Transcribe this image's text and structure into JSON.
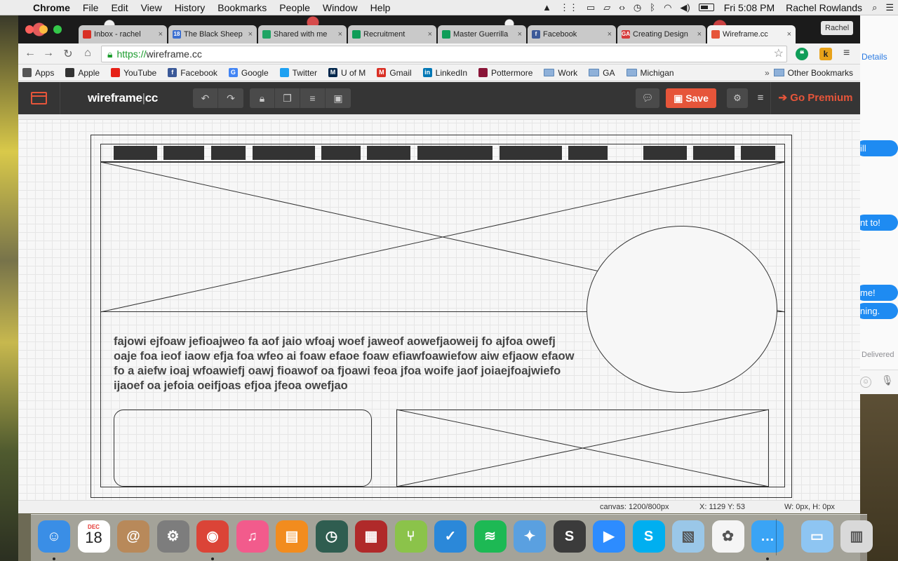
{
  "menubar": {
    "app_name": "Chrome",
    "items": [
      "File",
      "Edit",
      "View",
      "History",
      "Bookmarks",
      "People",
      "Window",
      "Help"
    ],
    "clock": "Fri 5:08 PM",
    "user": "Rachel Rowlands"
  },
  "browser": {
    "tabs": [
      {
        "label": "Inbox - rachel",
        "icon": "gmail-icon",
        "color": "#d93025"
      },
      {
        "label": "The Black Sheep",
        "icon": "calendar-icon",
        "color": "#3b6fd1",
        "icon_text": "18"
      },
      {
        "label": "Shared with me",
        "icon": "drive-icon",
        "color": "#1fa463"
      },
      {
        "label": "Recruitment",
        "icon": "sheets-icon",
        "color": "#0f9d58"
      },
      {
        "label": "Master Guerrilla",
        "icon": "sheets-icon",
        "color": "#0f9d58"
      },
      {
        "label": "Facebook",
        "icon": "facebook-icon",
        "color": "#3b5998",
        "icon_text": "f"
      },
      {
        "label": "Creating Design",
        "icon": "ga-icon",
        "color": "#d63b3b",
        "icon_text": "GA"
      },
      {
        "label": "Wireframe.cc",
        "icon": "wireframe-icon",
        "color": "#e6553a",
        "active": true
      }
    ],
    "profile_button": "Rachel",
    "url_scheme": "https://",
    "url_host": "wireframe.cc",
    "bookmarks": [
      {
        "label": "Apps",
        "icon": "apps-grid-icon",
        "color": "#555"
      },
      {
        "label": "Apple",
        "icon": "apple-icon",
        "color": "#333"
      },
      {
        "label": "YouTube",
        "icon": "youtube-icon",
        "color": "#e62117"
      },
      {
        "label": "Facebook",
        "icon": "facebook-icon",
        "color": "#3b5998",
        "icon_text": "f"
      },
      {
        "label": "Google",
        "icon": "google-icon",
        "color": "#4285f4",
        "icon_text": "G"
      },
      {
        "label": "Twitter",
        "icon": "twitter-icon",
        "color": "#1da1f2"
      },
      {
        "label": "U of M",
        "icon": "umich-icon",
        "color": "#00274c",
        "icon_text": "M"
      },
      {
        "label": "Gmail",
        "icon": "gmail-icon",
        "color": "#d93025",
        "icon_text": "M"
      },
      {
        "label": "LinkedIn",
        "icon": "linkedin-icon",
        "color": "#0077b5",
        "icon_text": "in"
      },
      {
        "label": "Pottermore",
        "icon": "pottermore-icon",
        "color": "#8a1538"
      },
      {
        "label": "Work",
        "icon": "folder-icon",
        "folder": true
      },
      {
        "label": "GA",
        "icon": "folder-icon",
        "folder": true
      },
      {
        "label": "Michigan",
        "icon": "folder-icon",
        "folder": true
      }
    ],
    "bookmarks_overflow": "»",
    "other_bookmarks": "Other Bookmarks"
  },
  "app": {
    "brand_main": "wireframe",
    "brand_sep": "|",
    "brand_suffix": "cc",
    "save_label": "Save",
    "premium_label": "Go Premium",
    "accent_color": "#e6553a"
  },
  "wireframe": {
    "nav_block_count": 12,
    "body_text": "fajowi ejfoaw jefioajweo fa aof jaio wfoaj woef jaweof aowefjaoweij fo ajfoa owefj oaje foa ieof iaow efja foa wfeo ai foaw efaoe foaw efiawfoawiefow aiw efjaow efaow fo a aiefw ioaj wfoawiefj oawj fioawof oa fjoawi feoa jfoa woife jaof joiaejfoajwiefo ijaoef oa jefoia oeifjoas efjoa jfeoa owefjao"
  },
  "status": {
    "canvas_size": "canvas: 1200/800px",
    "cursor": "X: 1129 Y: 53",
    "selection_size": "W: 0px, H: 0px"
  },
  "messages": {
    "link": "Details",
    "bubbles": [
      "ill",
      "nt to!",
      "me!",
      "ning."
    ],
    "delivered": "Delivered"
  },
  "dock": {
    "apps": [
      {
        "name": "finder-icon",
        "color": "#3a8ee6"
      },
      {
        "name": "calendar-icon",
        "color": "#ffffff",
        "month": "DEC",
        "day": "18"
      },
      {
        "name": "contacts-icon",
        "color": "#b8895a"
      },
      {
        "name": "system-preferences-icon",
        "color": "#7d7d7d"
      },
      {
        "name": "chrome-icon",
        "color": "#db4437"
      },
      {
        "name": "itunes-icon",
        "color": "#f25b8c"
      },
      {
        "name": "ibooks-icon",
        "color": "#f28c1e"
      },
      {
        "name": "time-machine-icon",
        "color": "#2f5d50"
      },
      {
        "name": "photo-booth-icon",
        "color": "#b02a2a"
      },
      {
        "name": "sourcetree-icon",
        "color": "#8bc34a"
      },
      {
        "name": "wunderlist-icon",
        "color": "#2b88d9"
      },
      {
        "name": "spotify-icon",
        "color": "#1db954"
      },
      {
        "name": "launchpad-icon",
        "color": "#5aa0e0"
      },
      {
        "name": "sublime-text-icon",
        "color": "#3b3b3b"
      },
      {
        "name": "zoom-icon",
        "color": "#2d8cff"
      },
      {
        "name": "skype-icon",
        "color": "#00aff0"
      },
      {
        "name": "preview-icon",
        "color": "#9ac7e8"
      },
      {
        "name": "photos-icon",
        "color": "#f5f5f5"
      },
      {
        "name": "messages-icon",
        "color": "#3aa4f5"
      },
      {
        "name": "downloads-folder-icon",
        "color": "#8ec5f2"
      },
      {
        "name": "trash-icon",
        "color": "#d9d9d9"
      }
    ]
  }
}
